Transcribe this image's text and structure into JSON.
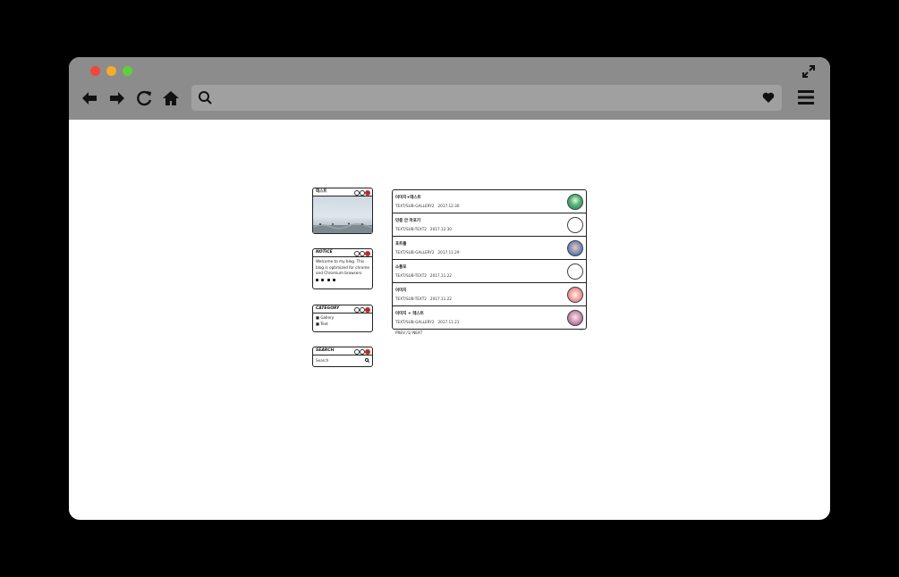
{
  "sidebar": {
    "profile": {
      "title": "테스트"
    },
    "notice": {
      "title": "NOTICE",
      "text": "Welcome to my blog. This blog is optimized for chrome and Chromium browsers."
    },
    "category": {
      "title": "CATEGORY",
      "items": [
        {
          "label": "Gallery"
        },
        {
          "label": "Text"
        }
      ]
    },
    "search": {
      "title": "SEARCH",
      "placeholder": "Search"
    }
  },
  "posts": [
    {
      "title": "이미지+테스트",
      "category": "TEXT/SUB-GALLERY2",
      "date": "2017.12.30",
      "thumb": "green-photo"
    },
    {
      "title": "민중 안 마포기",
      "category": "TEXT/SUB-TEXT2",
      "date": "2017.12.30",
      "thumb": "empty"
    },
    {
      "title": "포트폴",
      "category": "TEXT/SUB-GALLERY2",
      "date": "2017.11.29",
      "thumb": "blue-photo"
    },
    {
      "title": "소통포",
      "category": "TEXT/SUB-TEXT2",
      "date": "2017.11.22",
      "thumb": "empty"
    },
    {
      "title": "이미지",
      "category": "TEXT/SUB-TEXT2",
      "date": "2017.11.22",
      "thumb": "pink-photo"
    },
    {
      "title": "이미지 + 테스트",
      "category": "TEXT/SUB-GALLERY2",
      "date": "2017.11.21",
      "thumb": "purple-photo"
    }
  ],
  "pager": {
    "prev": "PREV",
    "current": "/1/",
    "next": "NEXT"
  },
  "colors": {
    "chrome": "#8c8c8c",
    "close": "#f0473b",
    "minimize": "#f6ab2b",
    "maximize": "#5fcf3b"
  }
}
